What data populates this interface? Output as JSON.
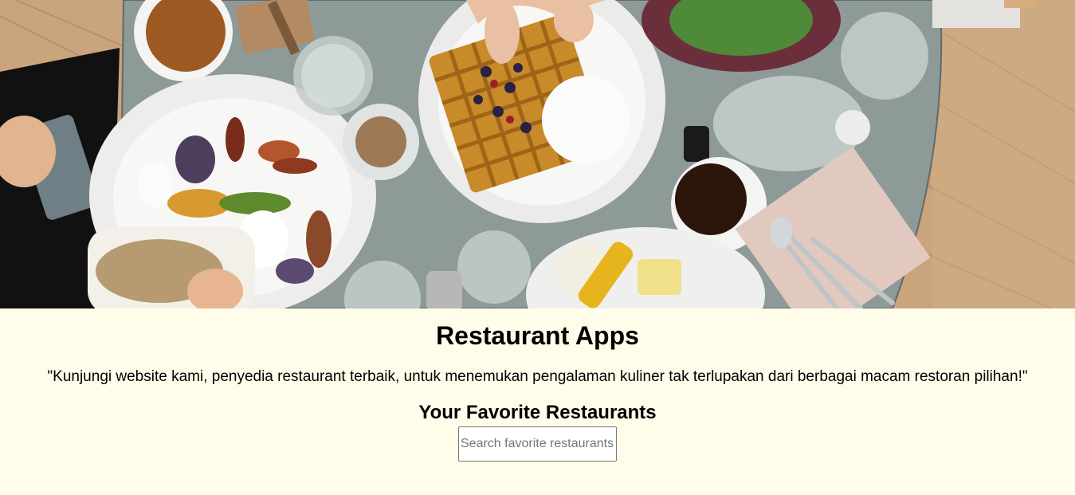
{
  "hero": {
    "image_alt": "Top-down view of a restaurant table with waffles, coffee, salad and roasted vegetables"
  },
  "header": {
    "title": "Restaurant Apps",
    "tagline": "\"Kunjungi website kami, penyedia restaurant terbaik, untuk menemukan pengalaman kuliner tak terlupakan dari berbagai macam restoran pilihan!\""
  },
  "favorites": {
    "heading": "Your Favorite Restaurants",
    "search": {
      "value": "",
      "placeholder": "Search favorite restaurants"
    }
  },
  "colors": {
    "page_background": "#fffde9",
    "table_top": "#8e9a98",
    "wood_floor": "#c9a47c"
  }
}
